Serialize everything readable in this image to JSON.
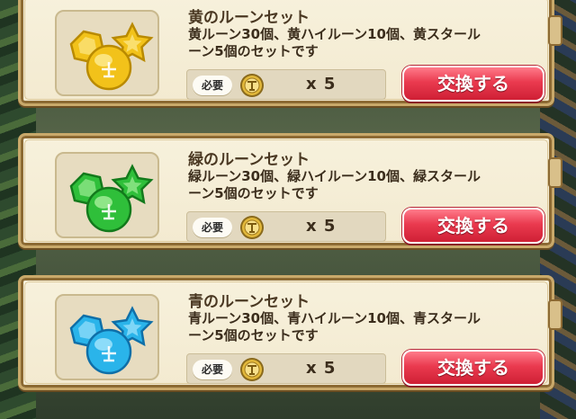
{
  "items": [
    {
      "title": "黄のルーンセット",
      "desc_line1": "黄ルーン30個、黄ハイルーン10個、黄スタール",
      "desc_line2": "ーン5個のセットです",
      "required_label": "必要",
      "quantity": "x 5",
      "button_label": "交換する",
      "gem_color": "#f2c21a",
      "gem_dark": "#b98a00",
      "gem_light": "#fff2a6",
      "gem_icon": "yellow-rune-set-icon"
    },
    {
      "title": "緑のルーンセット",
      "desc_line1": "緑ルーン30個、緑ハイルーン10個、緑スタール",
      "desc_line2": "ーン5個のセットです",
      "required_label": "必要",
      "quantity": "x 5",
      "button_label": "交換する",
      "gem_color": "#2fbf3a",
      "gem_dark": "#137a1c",
      "gem_light": "#b8f7a9",
      "gem_icon": "green-rune-set-icon"
    },
    {
      "title": "青のルーンセット",
      "desc_line1": "青ルーン30個、青ハイルーン10個、青スタール",
      "desc_line2": "ーン5個のセットです",
      "required_label": "必要",
      "quantity": "x 5",
      "button_label": "交換する",
      "gem_color": "#2ab4ea",
      "gem_dark": "#0f6fa8",
      "gem_light": "#b7ecff",
      "gem_icon": "blue-rune-set-icon"
    }
  ],
  "colors": {
    "button": "#ea3a4f",
    "card": "#f5eed7",
    "frame": "#c9a96a",
    "coin": "#e2b83a"
  }
}
